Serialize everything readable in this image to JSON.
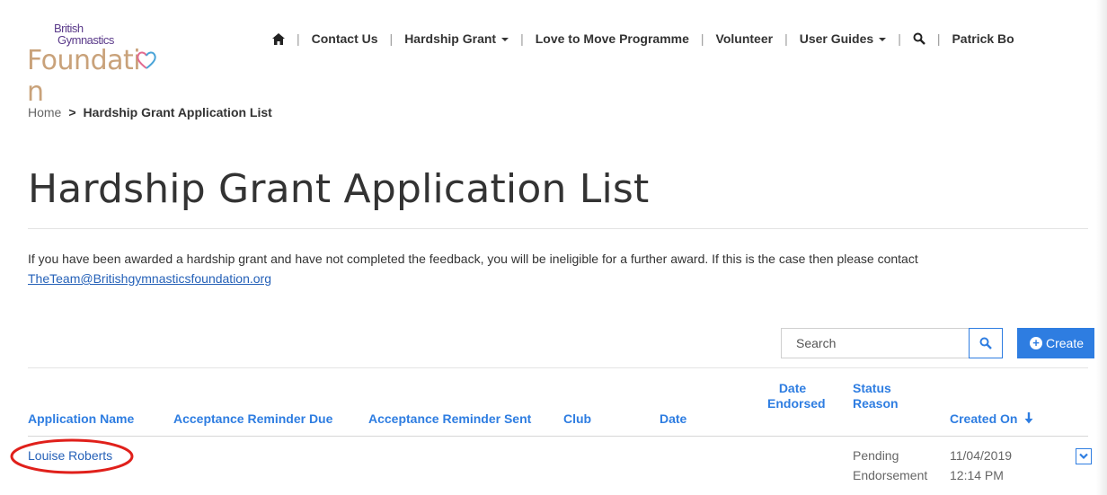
{
  "logo": {
    "line1": "British",
    "line2": "Gymnastics",
    "line3": "Foundati",
    "line3_end": "n"
  },
  "nav": {
    "home_icon": "home-icon",
    "items": [
      "Contact Us",
      "Hardship Grant",
      "Love to Move Programme",
      "Volunteer",
      "User Guides"
    ],
    "search_icon": "search-icon",
    "user": "Patrick Bo"
  },
  "breadcrumb": {
    "home": "Home",
    "current": "Hardship Grant Application List"
  },
  "title": "Hardship Grant Application List",
  "notice": {
    "text": "If you have been awarded a hardship grant and have not completed the feedback, you will be ineligible for a further award. If this is the case then please contact",
    "email": "TheTeam@Britishgymnasticsfoundation.org"
  },
  "search": {
    "placeholder": "Search",
    "button_icon": "search-icon"
  },
  "create": {
    "label": "Create"
  },
  "table": {
    "headers": {
      "application_name": "Application Name",
      "acceptance_due": "Acceptance Reminder Due",
      "acceptance_sent": "Acceptance Reminder Sent",
      "club": "Club",
      "date": "Date",
      "date_endorsed_1": "Date",
      "date_endorsed_2": "Endorsed",
      "status_1": "Status",
      "status_2": "Reason",
      "created_on": "Created On"
    },
    "rows": [
      {
        "application_name": "Louise Roberts",
        "status_1": "Pending",
        "status_2": "Endorsement",
        "created_date": "11/04/2019",
        "created_time": "12:14 PM"
      }
    ]
  },
  "colors": {
    "accent": "#2e7de1",
    "link": "#2561b8",
    "annotation": "#e0201b",
    "logo_purple": "#5a3a8a",
    "logo_gold": "#c9a27a"
  }
}
